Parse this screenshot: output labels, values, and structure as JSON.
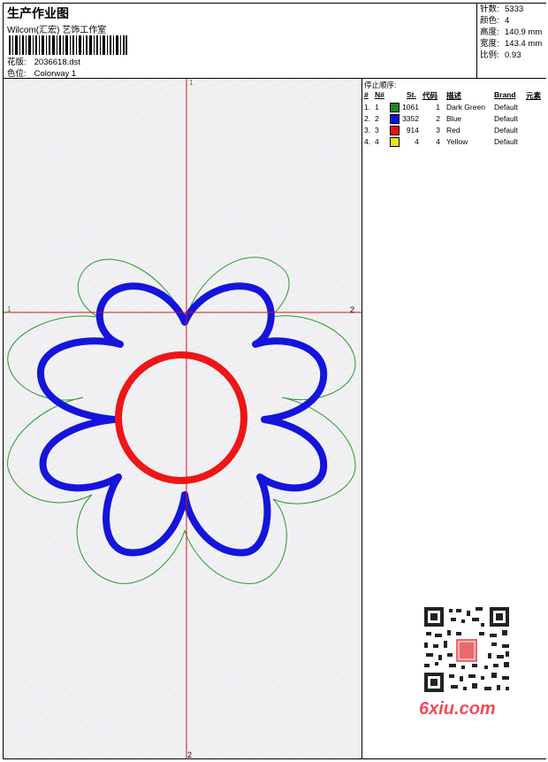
{
  "header": {
    "title": "生产作业图",
    "subtitle": "Wilcom(汇宏) 艺饰工作室",
    "design_label": "花版:",
    "design_value": "2036618.dst",
    "colorway_label": "色位:",
    "colorway_value": "Colorway 1"
  },
  "specs": {
    "stitches_label": "针数:",
    "stitches_value": "5333",
    "colors_label": "颜色:",
    "colors_value": "4",
    "height_label": "高度:",
    "height_value": "140.9 mm",
    "width_label": "宽度:",
    "width_value": "143.4 mm",
    "scale_label": "比例:",
    "scale_value": "0.93"
  },
  "stop_sequence": {
    "caption": "停止顺序:",
    "headers": {
      "hash": "#",
      "n": "N#",
      "st": "St.",
      "code": "代码",
      "desc": "描述",
      "brand": "Brand",
      "element": "元素"
    },
    "rows": [
      {
        "idx": "1.",
        "n": "1",
        "color": "#1a8a1a",
        "st": "1061",
        "code": "1",
        "desc": "Dark Green",
        "brand": "Default"
      },
      {
        "idx": "2.",
        "n": "2",
        "color": "#1010e0",
        "st": "3352",
        "code": "2",
        "desc": "Blue",
        "brand": "Default"
      },
      {
        "idx": "3.",
        "n": "3",
        "color": "#ee1111",
        "st": "914",
        "code": "3",
        "desc": "Red",
        "brand": "Default"
      },
      {
        "idx": "4.",
        "n": "4",
        "color": "#f2e21a",
        "st": "4",
        "code": "4",
        "desc": "Yellow",
        "brand": "Default"
      }
    ]
  },
  "crosshair": {
    "top": "1",
    "bottom": "2",
    "left": "1",
    "right": "2"
  },
  "colors": {
    "green": "#2a9a2a",
    "blue": "#1414dd",
    "red": "#ee1616",
    "crosshair": "#e01010"
  },
  "watermark": {
    "logo": "6xiu.com"
  }
}
